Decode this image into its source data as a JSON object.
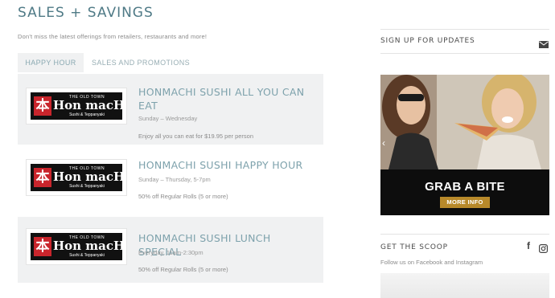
{
  "main": {
    "title": "SALES + SAVINGS",
    "subtitle": "Don't miss the latest offerings from retailers, restaurants and more!",
    "tabs": [
      {
        "label": "HAPPY HOUR",
        "active": true
      },
      {
        "label": "SALES AND PROMOTIONS",
        "active": false
      }
    ],
    "logo": {
      "glyph": "本",
      "top_text": "THE OLD TOWN",
      "main_text": "Hon macHi",
      "sub_text": "Sushi & Teppanyaki"
    },
    "deals": [
      {
        "title": "HONMACHI SUSHI ALL YOU CAN EAT",
        "when": "Sunday – Wednesday",
        "description": "Enjoy all you can eat for $19.95 per person"
      },
      {
        "title": "HONMACHI SUSHI HAPPY HOUR",
        "when": "Sunday – Thursday, 5-7pm",
        "description": "50% off Regular Rolls (5 or more)"
      },
      {
        "title": "HONMACHI SUSHI LUNCH SPECIAL",
        "when": "Everyday, 11am-2:30pm",
        "description": "50% off Regular Rolls (5 or more)"
      }
    ]
  },
  "sidebar": {
    "signup_heading": "SIGN UP FOR UPDATES",
    "ad": {
      "title": "GRAB A BITE",
      "button_label": "MORE INFO"
    },
    "scoop_heading": "GET THE SCOOP",
    "scoop_text": "Follow us on Facebook and Instagram",
    "facebook_glyph": "f"
  },
  "colors": {
    "title": "#4f7a86",
    "deal_title": "#7ea2ac",
    "tile_bg": "#f0f1f2",
    "ad_button": "#b8892a"
  }
}
